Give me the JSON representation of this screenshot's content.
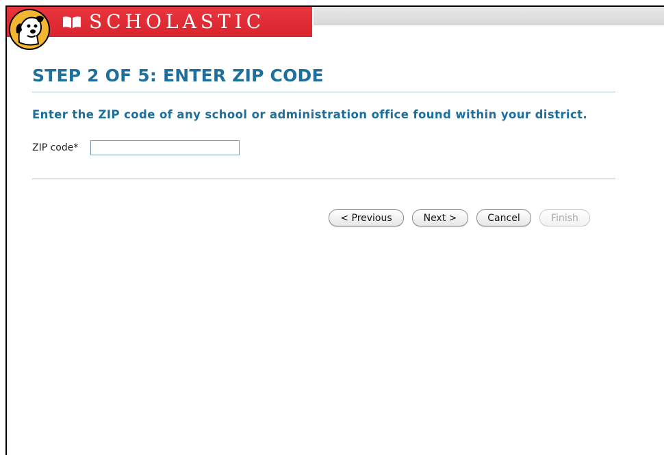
{
  "header": {
    "brand_name": "SCHOLASTIC",
    "brand_color": "#e0282f",
    "mascot_icon": "clifford-dog-icon",
    "book_icon": "open-book-icon"
  },
  "wizard": {
    "title": "STEP 2 OF 5: ENTER ZIP CODE",
    "instruction": "Enter the ZIP code of any school or administration office found within your district.",
    "zip_label": "ZIP code*",
    "zip_value": "",
    "zip_placeholder": "",
    "accent_color": "#1f6f9c"
  },
  "buttons": {
    "previous": "< Previous",
    "next": "Next >",
    "cancel": "Cancel",
    "finish": "Finish",
    "finish_disabled": true
  }
}
